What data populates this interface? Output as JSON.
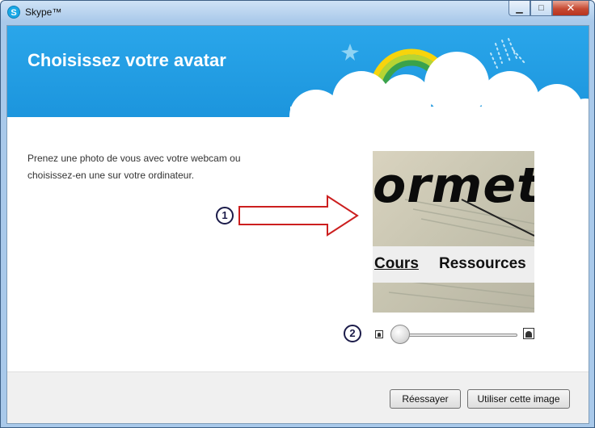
{
  "window": {
    "title": "Skype™",
    "logo_letter": "S",
    "controls": {
      "minimize": "▁",
      "maximize": "□",
      "close": "✕"
    }
  },
  "banner": {
    "title": "Choisissez votre avatar"
  },
  "intro": {
    "text": "Prenez une photo de vous avec votre webcam ou choisissez-en une sur votre ordinateur."
  },
  "markers": {
    "one": "1",
    "two": "2"
  },
  "avatar": {
    "word": "ormett",
    "link_cours": "Cours",
    "link_ressources": "Ressources"
  },
  "zoom": {
    "value": 0
  },
  "footer": {
    "retry_label": "Réessayer",
    "use_label": "Utiliser cette image"
  },
  "colors": {
    "banner": "#1c95dd",
    "arrow": "#cc1f1f",
    "rainbow": [
      "#f7d40c",
      "#8bc63f",
      "#3aa24b"
    ]
  }
}
